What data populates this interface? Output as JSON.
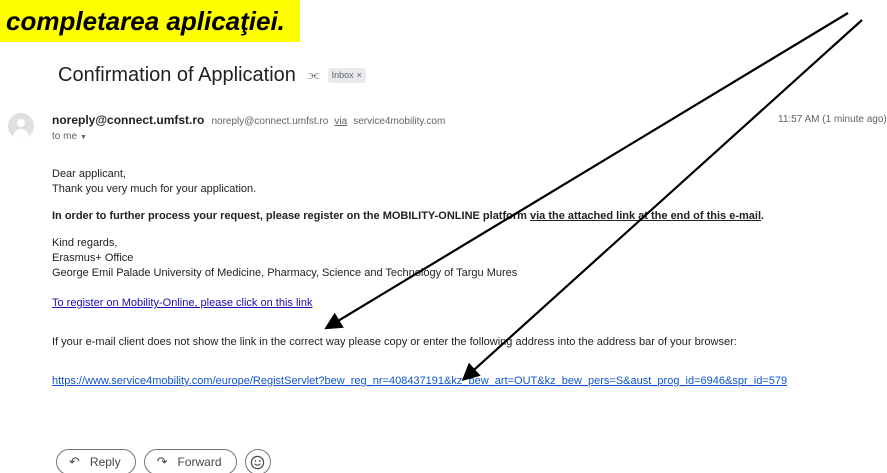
{
  "banner": {
    "text": "completarea aplicaţiei."
  },
  "email": {
    "subject": "Confirmation of Application",
    "label_chip": "Inbox",
    "chip_close": "×",
    "sender_name": "noreply@connect.umfst.ro",
    "sender_email": "noreply@connect.umfst.ro",
    "via_label": "via",
    "via_domain": "service4mobility.com",
    "recipient": "to me",
    "time": "11:57 AM (1 minute ago)"
  },
  "body": {
    "greeting": "Dear applicant,",
    "thanks": "Thank you very much for your application.",
    "instruction_main": "In order to further process your request, please register on the MOBILITY-ONLINE platform ",
    "instruction_link": "via the attached link at the end of this e-mail",
    "instruction_end": ".",
    "regards": "Kind regards,",
    "office": "Erasmus+ Office",
    "university": "George Emil Palade University of Medicine, Pharmacy, Science and Technology of Targu Mures",
    "register_link": "To register on Mobility-Online, please click on this link",
    "fallback_text": "If your e-mail client does not show the link in the correct way please copy or enter the following address into the address bar of your browser:",
    "url": "https://www.service4mobility.com/europe/RegistServlet?bew_reg_nr=408437191&kz_bew_art=OUT&kz_bew_pers=S&aust_prog_id=6946&spr_id=579"
  },
  "actions": {
    "reply_label": "Reply",
    "forward_label": "Forward"
  },
  "icons": {
    "importance": "importance-marker-icon",
    "reply": "reply-icon",
    "forward": "forward-icon",
    "emoji": "emoji-reaction-icon"
  },
  "colors": {
    "banner_bg": "#ffff00",
    "link": "#1a0dab",
    "url": "#1155cc",
    "arrow": "#000000"
  }
}
